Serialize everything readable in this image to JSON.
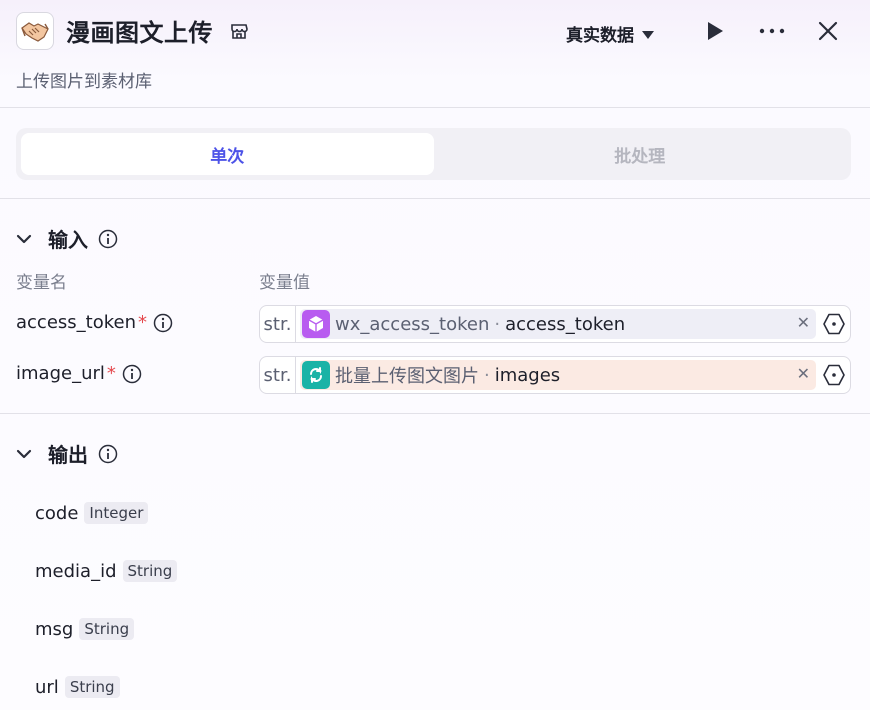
{
  "header": {
    "title": "漫画图文上传",
    "subtitle": "上传图片到素材库",
    "data_mode": "真实数据"
  },
  "tabs": [
    {
      "label": "单次",
      "active": true
    },
    {
      "label": "批处理",
      "active": false
    }
  ],
  "input_section": {
    "title": "输入",
    "col_name": "变量名",
    "col_value": "变量值",
    "rows": [
      {
        "name": "access_token",
        "required": "*",
        "type": "str.",
        "node": "wx_access_token",
        "sep": "·",
        "field": "access_token",
        "icon": "cube-icon",
        "color": "#eeeef6"
      },
      {
        "name": "image_url",
        "required": "*",
        "type": "str.",
        "node": "批量上传图文图片",
        "sep": "·",
        "field": "images",
        "icon": "loop-icon",
        "color": "#fbeae3"
      }
    ]
  },
  "output_section": {
    "title": "输出",
    "items": [
      {
        "name": "code",
        "type": "Integer"
      },
      {
        "name": "media_id",
        "type": "String"
      },
      {
        "name": "msg",
        "type": "String"
      },
      {
        "name": "url",
        "type": "String"
      }
    ]
  },
  "colors": {
    "accent": "#4d53e8",
    "cube": "#b85cf0",
    "loop": "#1ab3a6"
  }
}
